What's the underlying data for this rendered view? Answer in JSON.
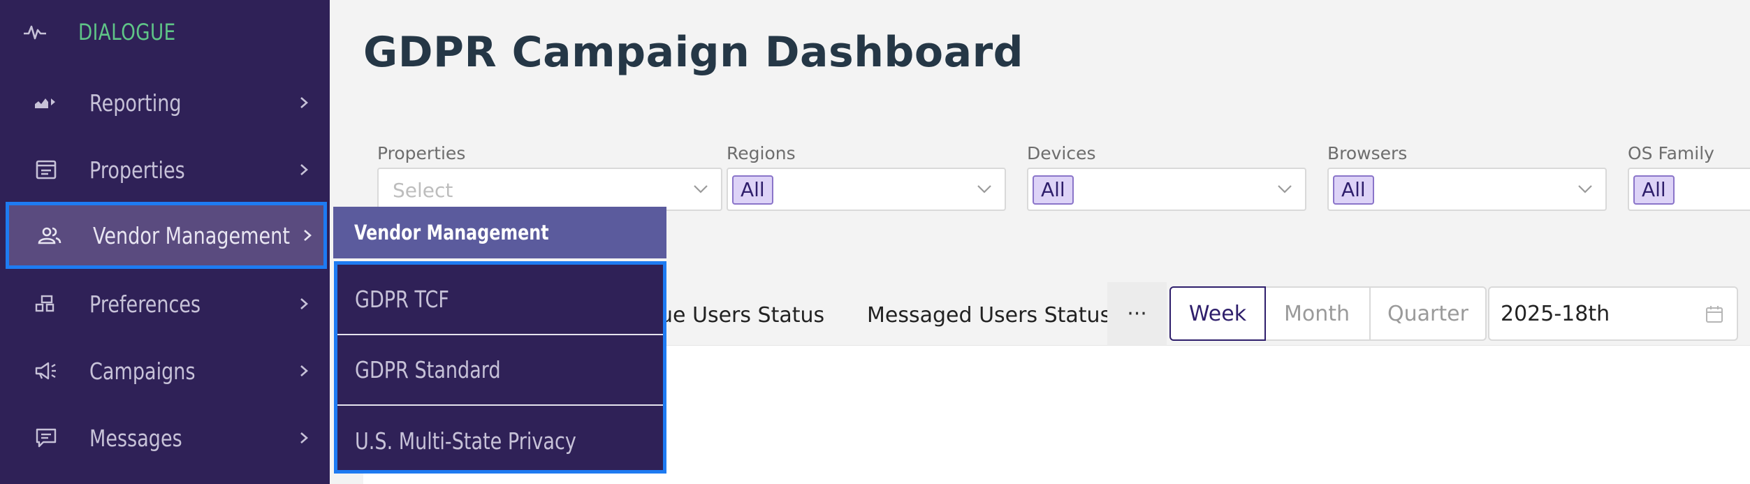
{
  "sidebar": {
    "brand": "DIALOGUE",
    "items": [
      {
        "label": "Reporting",
        "icon": "chart-icon"
      },
      {
        "label": "Properties",
        "icon": "properties-icon"
      },
      {
        "label": "Vendor Management",
        "icon": "users-icon"
      },
      {
        "label": "Preferences",
        "icon": "preferences-icon"
      },
      {
        "label": "Campaigns",
        "icon": "megaphone-icon"
      },
      {
        "label": "Messages",
        "icon": "message-icon"
      }
    ]
  },
  "flyout": {
    "header": "Vendor Management",
    "items": [
      "GDPR TCF",
      "GDPR Standard",
      "U.S. Multi-State Privacy"
    ]
  },
  "page": {
    "title": "GDPR Campaign Dashboard"
  },
  "filters": {
    "properties": {
      "label": "Properties",
      "placeholder": "Select"
    },
    "regions": {
      "label": "Regions",
      "value": "All"
    },
    "devices": {
      "label": "Devices",
      "value": "All"
    },
    "browsers": {
      "label": "Browsers",
      "value": "All"
    },
    "os_family": {
      "label": "OS Family",
      "value": "All"
    }
  },
  "tabs": [
    "ue Users Status",
    "Messaged Users Status"
  ],
  "more_label": "···",
  "period": {
    "options": [
      "Week",
      "Month",
      "Quarter"
    ],
    "selected": "Week"
  },
  "date": {
    "value": "2025-18th"
  },
  "colors": {
    "sidebar": "#2f2157",
    "brand": "#5fc587",
    "accent": "#1e7bf2",
    "flyout_header": "#5b5b9d",
    "selected": "#2e1e6b"
  }
}
